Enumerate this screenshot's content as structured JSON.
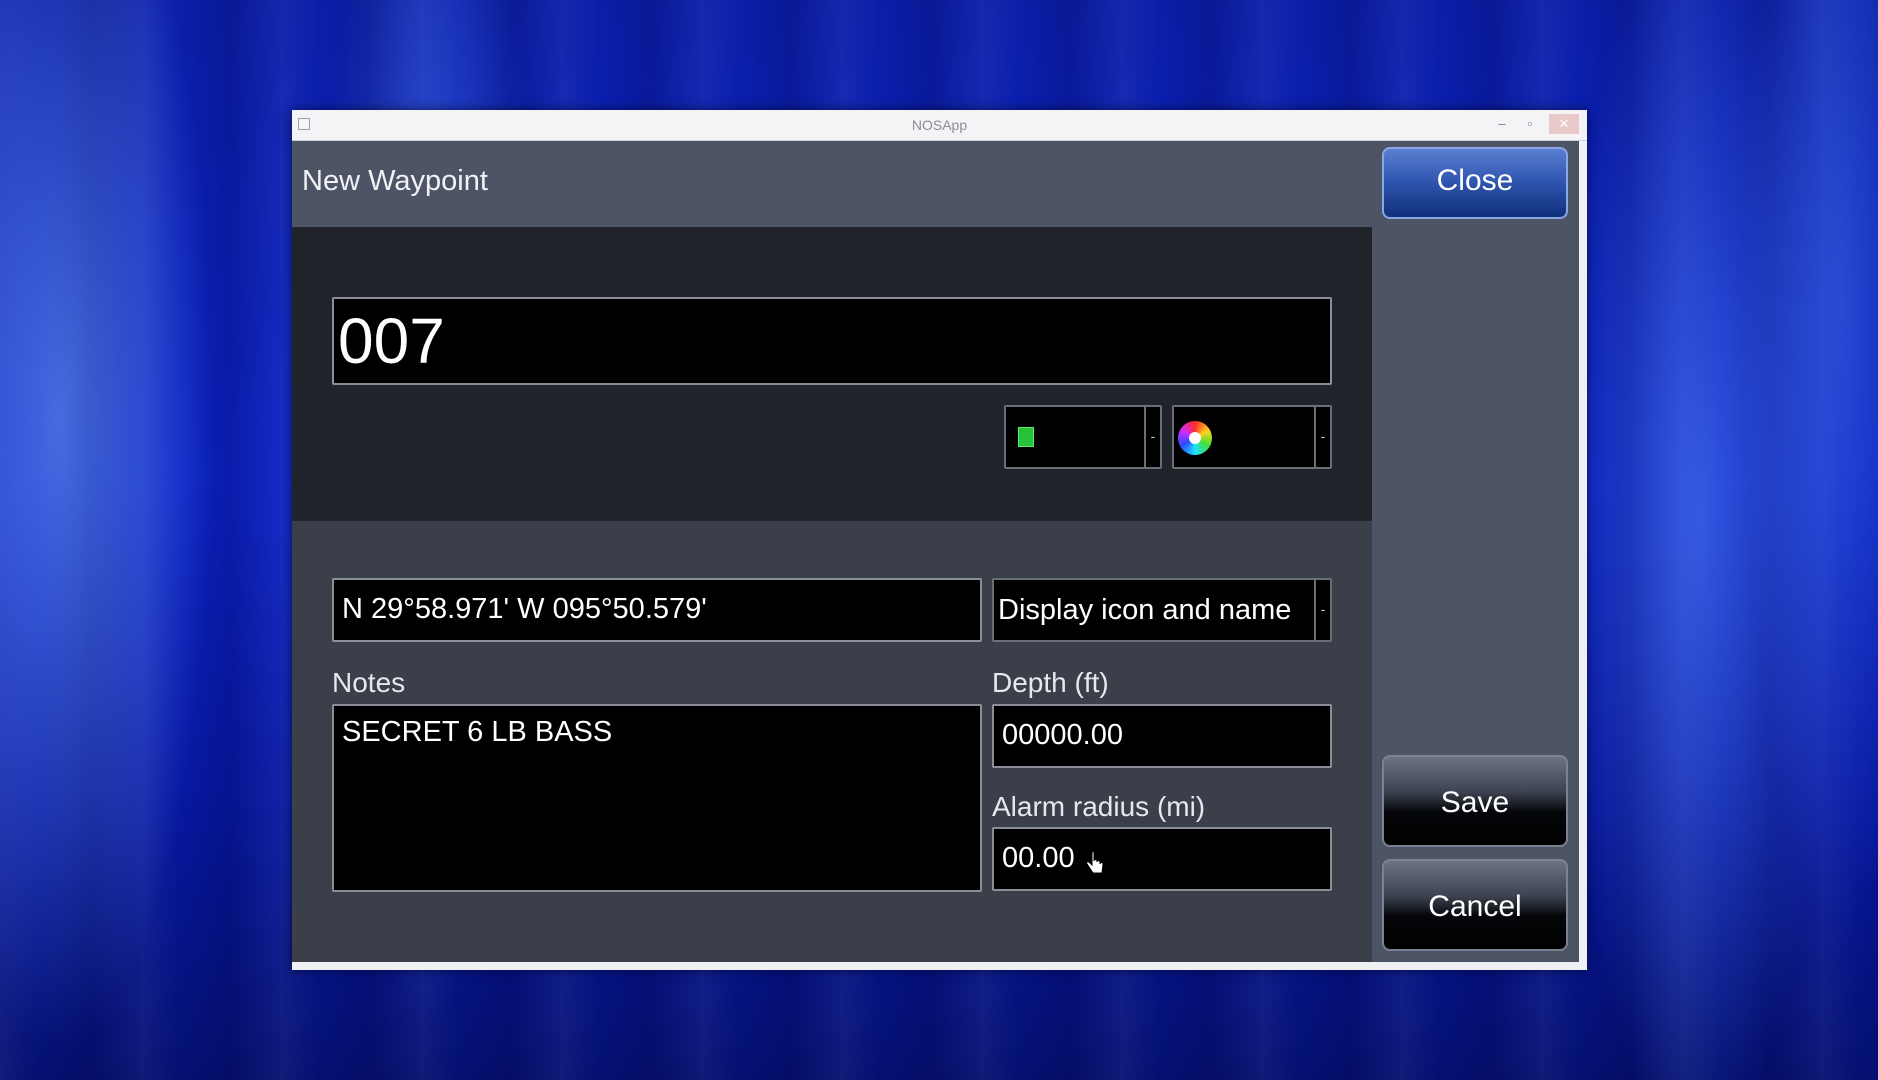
{
  "window": {
    "title": "NOSApp",
    "controls": {
      "minimize": "–",
      "maximize": "▫",
      "close": "✕"
    }
  },
  "dialog": {
    "title": "New Waypoint",
    "close_label": "Close",
    "save_label": "Save",
    "cancel_label": "Cancel"
  },
  "waypoint": {
    "name": "007",
    "icon": "waypoint-symbol-icon",
    "color": "color-wheel-icon",
    "position": "N 29°58.971'   W 095°50.579'",
    "display_mode": "Display icon and name",
    "notes_label": "Notes",
    "notes": "SECRET 6 LB BASS",
    "depth_label": "Depth (ft)",
    "depth": "00000.00",
    "alarm_label": "Alarm radius (mi)",
    "alarm_radius": "00.00"
  },
  "colors": {
    "header_bg": "#4d5466",
    "panel_dark": "#20232a",
    "accent_button": "#2f55b0",
    "symbol_green": "#27c23a"
  }
}
